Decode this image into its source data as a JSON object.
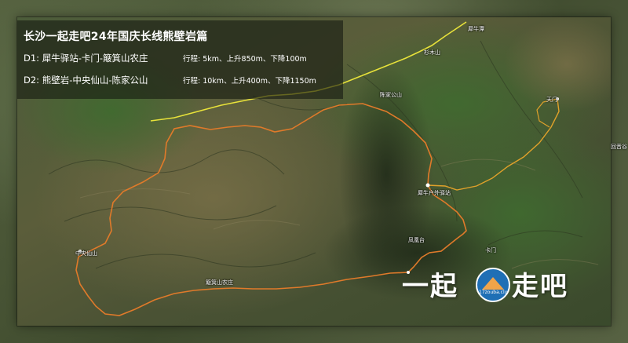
{
  "title": "长沙一起走吧24年国庆长线熊壁岩篇",
  "routes": [
    {
      "day": "D1",
      "name": "D1: 犀牛驿站-卡门-簸箕山农庄",
      "stats": "行程: 5km、上升850m、下降100m",
      "color": "#e8e23a"
    },
    {
      "day": "D2",
      "name": "D2: 熊壁岩-中央仙山-陈家公山",
      "stats": "行程: 10km、上升400m、下降1150m",
      "color": "#e07a2a"
    }
  ],
  "place_labels": {
    "xiniu_tan": "犀牛潭",
    "shankou_shan": "杉木山",
    "chenjia_gongshan": "陈家公山",
    "tianmen": "天门",
    "xiniu_station": "犀牛户外驿站",
    "fenghuang_tai": "凤凰台",
    "kamen": "卡门",
    "zhongyang_xianshan": "中央仙山",
    "boji_nongzhuang": "簸箕山农庄",
    "huiyuan": "回音谷"
  },
  "logo": {
    "left_text": "一起",
    "right_text": "走吧",
    "badge_url": "17zouba.club",
    "badge_color": "#1f6fb5",
    "accent_color": "#f0a44a"
  }
}
